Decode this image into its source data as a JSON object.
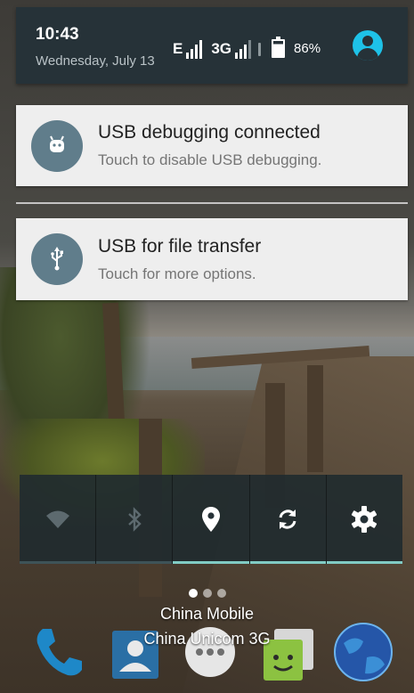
{
  "status_header": {
    "time": "10:43",
    "date": "Wednesday, July 13",
    "network_1": "E",
    "network_2": "3G",
    "battery_level": "86%"
  },
  "notifications": [
    {
      "title": "USB debugging connected",
      "subtitle": "Touch to disable USB debugging.",
      "icon": "android-debug-icon"
    },
    {
      "title": "USB for file transfer",
      "subtitle": "Touch for more options.",
      "icon": "usb-icon"
    }
  ],
  "quick_settings": [
    {
      "icon": "wifi-icon",
      "active": false
    },
    {
      "icon": "bluetooth-icon",
      "active": false
    },
    {
      "icon": "location-icon",
      "active": true
    },
    {
      "icon": "auto-rotate-icon",
      "active": true
    },
    {
      "icon": "settings-icon",
      "active": true
    }
  ],
  "carriers": [
    "China Mobile",
    "China Unicom 3G"
  ],
  "dock_apps": [
    "phone-icon",
    "contacts-icon",
    "app-drawer-icon",
    "messaging-icon",
    "browser-icon"
  ],
  "colors": {
    "header_bg": "#263238",
    "card_bg": "#eeeeee",
    "notification_icon_bg": "#607d8b",
    "avatar": "#1ec2e8",
    "tile_active_indicator": "#80cbc4"
  }
}
